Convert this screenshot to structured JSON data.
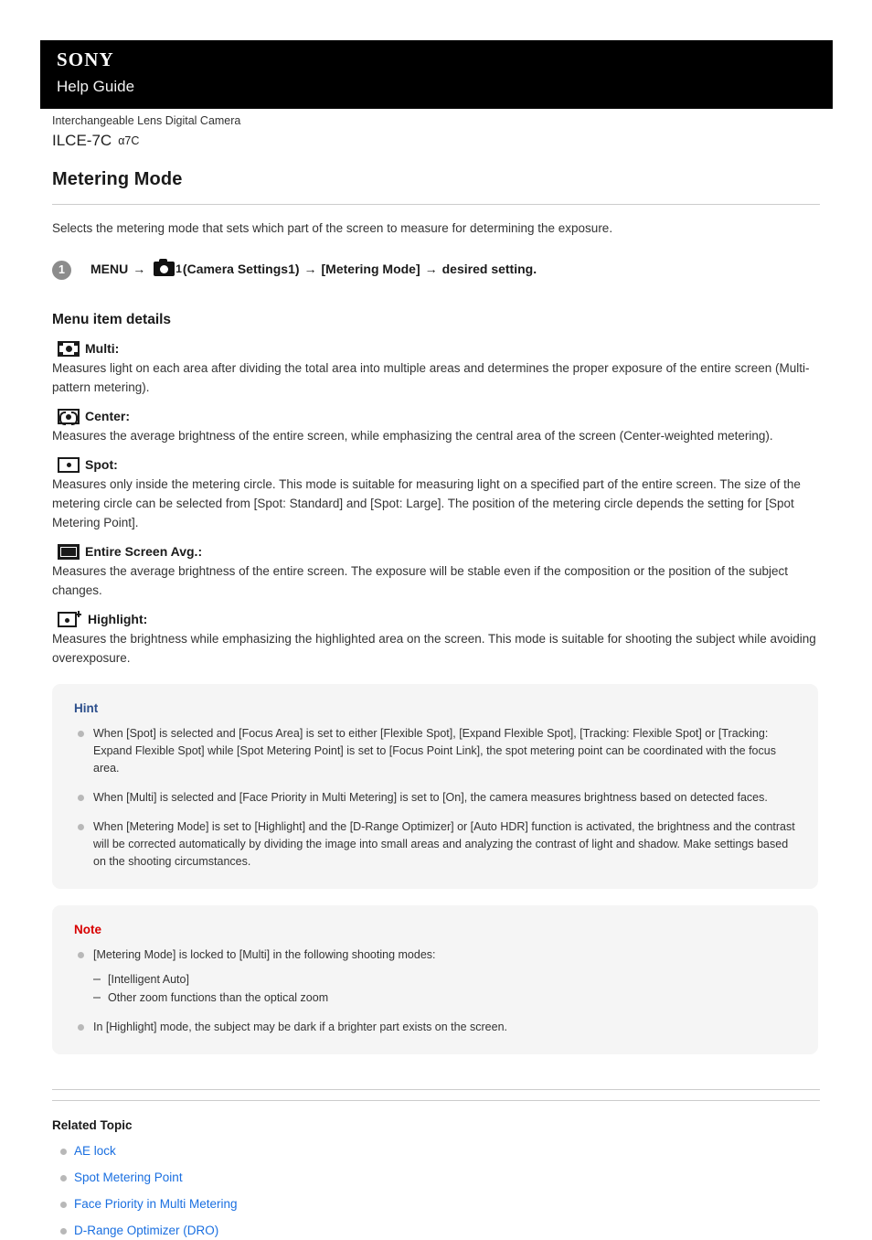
{
  "header": {
    "brand": "SONY",
    "subtitle": "Help Guide"
  },
  "product": {
    "category": "Interchangeable Lens Digital Camera",
    "model": "ILCE-7C",
    "alias": "α7C"
  },
  "article": {
    "title": "Metering Mode",
    "lede": "Selects the metering mode that sets which part of the screen to measure for determining the exposure.",
    "step": {
      "number": "1",
      "prefix": "MENU",
      "arrow1": "→",
      "camera_number": "1",
      "camera_group": "(Camera Settings1)",
      "arrow2": "→",
      "menu_item": "[Metering Mode]",
      "arrow3": "→",
      "suffix": "desired setting."
    },
    "section_title": "Menu item details",
    "menu_items": [
      {
        "icon": "metering-multi-icon",
        "label": "Multi:",
        "body": "Measures light on each area after dividing the total area into multiple areas and determines the proper exposure of the entire screen (Multi-pattern metering)."
      },
      {
        "icon": "metering-center-icon",
        "label": "Center:",
        "body": "Measures the average brightness of the entire screen, while emphasizing the central area of the screen (Center-weighted metering)."
      },
      {
        "icon": "metering-spot-icon",
        "label": "Spot:",
        "body": "Measures only inside the metering circle. This mode is suitable for measuring light on a specified part of the entire screen. The size of the metering circle can be selected from [Spot: Standard] and [Spot: Large]. The position of the metering circle depends the setting for [Spot Metering Point]."
      },
      {
        "icon": "metering-entire-screen-avg-icon",
        "label": "Entire Screen Avg.:",
        "body": "Measures the average brightness of the entire screen. The exposure will be stable even if the composition or the position of the subject changes."
      },
      {
        "icon": "metering-highlight-icon",
        "label": "Highlight:",
        "body": "Measures the brightness while emphasizing the highlighted area on the screen. This mode is suitable for shooting the subject while avoiding overexposure."
      }
    ],
    "hint": {
      "title": "Hint",
      "items": [
        "When [Spot] is selected and [Focus Area] is set to either [Flexible Spot], [Expand Flexible Spot], [Tracking: Flexible Spot] or [Tracking: Expand Flexible Spot] while [Spot Metering Point] is set to [Focus Point Link], the spot metering point can be coordinated with the focus area.",
        "When [Multi] is selected and [Face Priority in Multi Metering] is set to [On], the camera measures brightness based on detected faces.",
        "When [Metering Mode] is set to [Highlight] and the [D-Range Optimizer] or [Auto HDR] function is activated, the brightness and the contrast will be corrected automatically by dividing the image into small areas and analyzing the contrast of light and shadow. Make settings based on the shooting circumstances."
      ]
    },
    "note": {
      "title": "Note",
      "item1": "[Metering Mode] is locked to [Multi] in the following shooting modes:",
      "subitems": [
        "[Intelligent Auto]",
        "Other zoom functions than the optical zoom"
      ],
      "item2": "In [Highlight] mode, the subject may be dark if a brighter part exists on the screen."
    },
    "related": {
      "title": "Related Topic",
      "links": [
        "AE lock",
        "Spot Metering Point",
        "Face Priority in Multi Metering",
        "D-Range Optimizer (DRO)"
      ]
    }
  },
  "colors": {
    "header_bg": "#000000",
    "link": "#1a6fe0",
    "hint_title": "#2c4f8c",
    "note_title": "#d80000",
    "callout_bg": "#f5f5f5",
    "badge_bg": "#8c8c8c"
  }
}
